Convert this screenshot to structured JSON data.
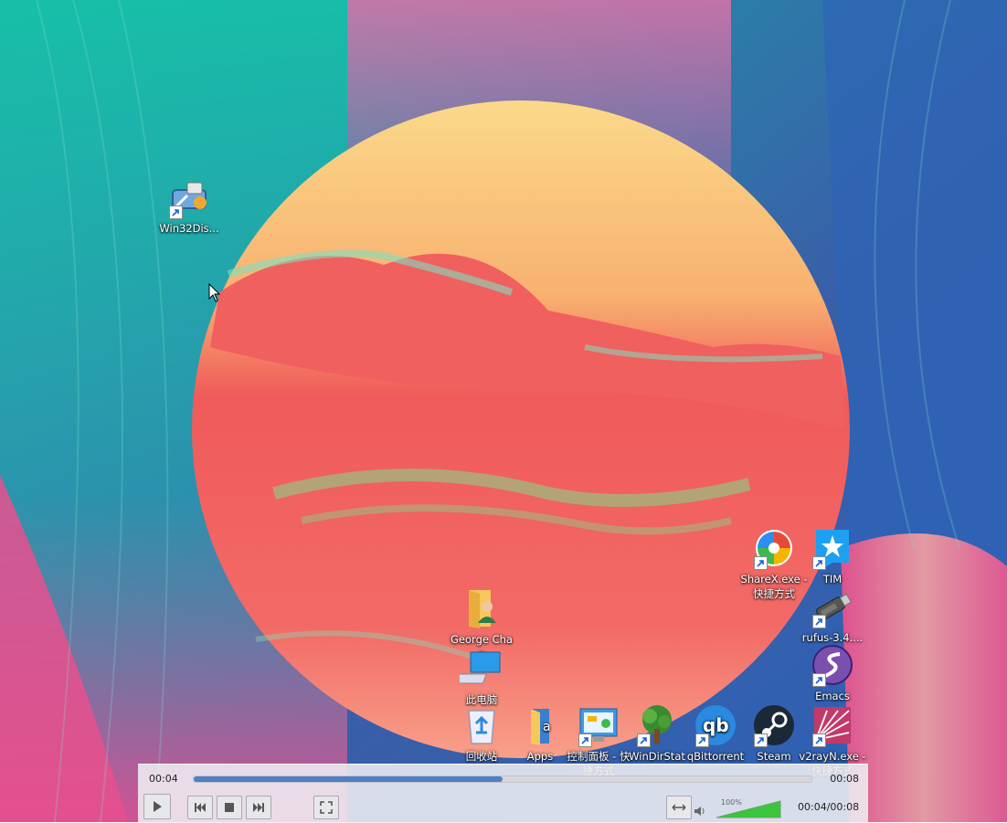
{
  "desktop": {
    "icons": [
      {
        "label": "Win32Dis...",
        "icon": "win32diskimager-icon"
      },
      {
        "label": "ShareX.exe - 快捷方式",
        "icon": "sharex-icon"
      },
      {
        "label": "TIM",
        "icon": "tim-icon"
      },
      {
        "label": "rufus-3.4....",
        "icon": "usb-drive-icon"
      },
      {
        "label": "Emacs",
        "icon": "emacs-icon"
      },
      {
        "label": "George Chan",
        "icon": "user-folder-icon"
      },
      {
        "label": "此电脑",
        "icon": "this-pc-icon"
      },
      {
        "label": "回收站",
        "icon": "recycle-bin-icon"
      },
      {
        "label": "Apps",
        "icon": "apps-icon"
      },
      {
        "label": "控制面板 - 快捷方式",
        "icon": "control-panel-icon"
      },
      {
        "label": "WinDirStat",
        "icon": "windirstat-icon"
      },
      {
        "label": "qBittorrent",
        "icon": "qbittorrent-icon"
      },
      {
        "label": "Steam",
        "icon": "steam-icon"
      },
      {
        "label": "v2rayN.exe - 快捷方式",
        "icon": "v2rayn-icon"
      }
    ]
  },
  "player": {
    "elapsed": "00:04",
    "total": "00:08",
    "progress": 0.5,
    "time_combined": "00:04/00:08",
    "volume_label": "100%",
    "volume": 1.0,
    "accent": "#4f7fc4",
    "volume_color": "#3cc43c"
  }
}
